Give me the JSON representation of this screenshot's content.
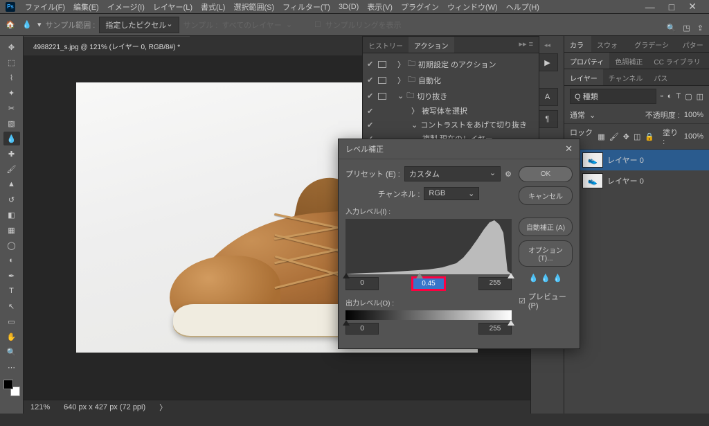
{
  "menu": {
    "file": "ファイル(F)",
    "edit": "編集(E)",
    "image": "イメージ(I)",
    "layer": "レイヤー(L)",
    "type": "書式(L)",
    "select": "選択範囲(S)",
    "filter": "フィルター(T)",
    "3d": "3D(D)",
    "view": "表示(V)",
    "plugin": "プラグイン",
    "window": "ウィンドウ(W)",
    "help": "ヘルプ(H)"
  },
  "opt": {
    "sample": "サンプル範囲 :",
    "sample_val": "指定したピクセル",
    "sample2": "サンプル :",
    "sample2_val": "すべてのレイヤー",
    "ring": "サンプルリングを表示"
  },
  "tab": "4988221_s.jpg @ 121% (レイヤー 0, RGB/8#) *",
  "status": {
    "zoom": "121%",
    "dims": "640 px x 427 px (72 ppi)"
  },
  "actions": {
    "tab_history": "ヒストリー",
    "tab_actions": "アクション",
    "root": "初期設定 のアクション",
    "auto": "自動化",
    "crop": "切り抜き",
    "dup": "被写体を選択",
    "contrast": "コントラストをあげて切り抜き",
    "dupcur": "複製 現在のレイヤー"
  },
  "panels": {
    "color": "カラー",
    "swatch": "スウォッチ",
    "grad": "グラデーション",
    "pattern": "パターン",
    "prop": "プロパティ",
    "adj": "色調補正",
    "cclib": "CC ライブラリ",
    "layer": "レイヤー",
    "channel": "チャンネル",
    "path": "パス",
    "kind": "Q 種類",
    "normal": "通常",
    "opacity": "不透明度 :",
    "opval": "100%",
    "lock": "ロック :",
    "fill": "塗り :",
    "fillval": "100%",
    "layer0": "レイヤー 0"
  },
  "dialog": {
    "title": "レベル補正",
    "preset": "プリセット (E) :",
    "preset_val": "カスタム",
    "channel": "チャンネル :",
    "channel_val": "RGB",
    "input": "入力レベル(I) :",
    "output": "出力レベル(O) :",
    "v_black": "0",
    "v_mid": "0.45",
    "v_white": "255",
    "o_black": "0",
    "o_white": "255",
    "ok": "OK",
    "cancel": "キャンセル",
    "auto": "自動補正 (A)",
    "options": "オプション(T)...",
    "preview": "プレビュー(P)"
  }
}
